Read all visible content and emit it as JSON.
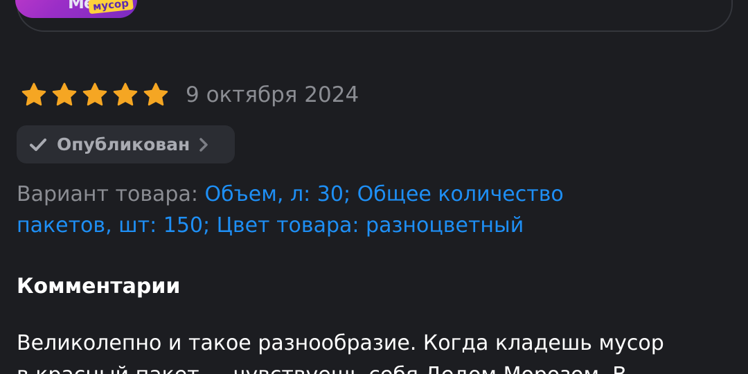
{
  "product": {
    "thumb_text": "Ме",
    "thumb_tag": "мусор"
  },
  "review": {
    "rating": 5,
    "max_rating": 5,
    "date": "9 октября 2024",
    "star_color": "#f5a623"
  },
  "status": {
    "label": "Опубликован",
    "icon": "checkmark-icon"
  },
  "variant": {
    "label": "Вариант товара:",
    "line1": "Объем, л: 30; Общее количество",
    "line2": "пакетов, шт: 150; Цвет товара: разноцветный",
    "link_color": "#1e8ff5"
  },
  "comments": {
    "heading": "Комментарии",
    "line1": "Великолепно и такое разнообразие. Когда кладешь мусор",
    "line2": "в красный пакет — чувствуешь себя Дедом Морозом. В"
  }
}
